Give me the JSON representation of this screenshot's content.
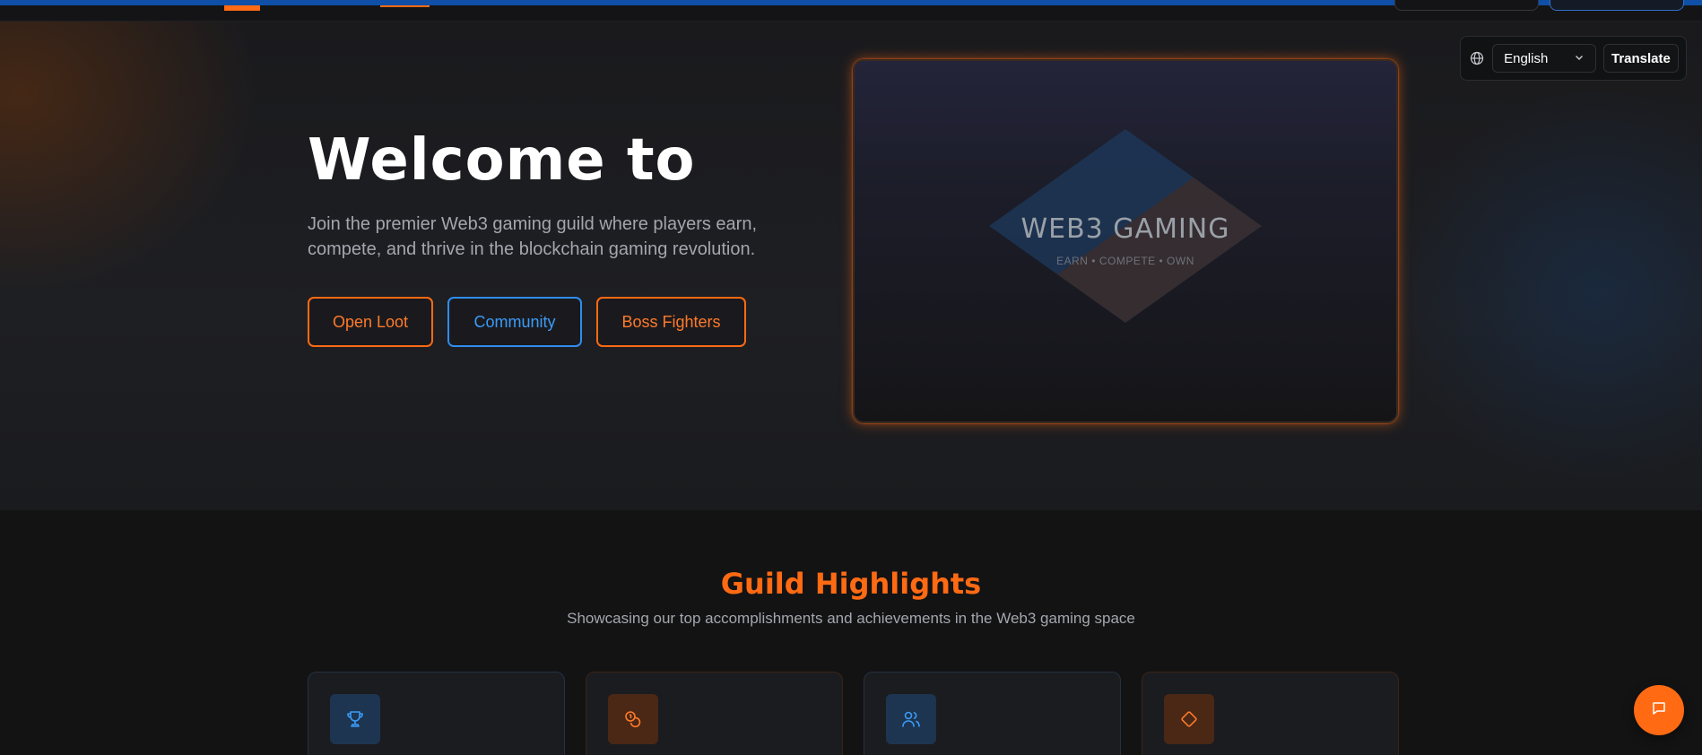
{
  "translate": {
    "language": "English",
    "button": "Translate"
  },
  "hero": {
    "title": "Welcome to",
    "subtitle": "Join the premier Web3 gaming guild where players earn, compete, and thrive in the blockchain gaming revolution.",
    "buttons": [
      {
        "label": "Open Loot",
        "style": "orange"
      },
      {
        "label": "Community",
        "style": "blue"
      },
      {
        "label": "Boss Fighters",
        "style": "orange"
      }
    ],
    "card": {
      "title": "WEB3 GAMING",
      "tagline": "EARN • COMPETE • OWN"
    }
  },
  "highlights": {
    "title": "Guild Highlights",
    "subtitle": "Showcasing our top accomplishments and achievements in the Web3 gaming space",
    "cards": [
      {
        "icon": "trophy-icon",
        "accent": "#2f8df0"
      },
      {
        "icon": "coins-icon",
        "accent": "#ff6a13"
      },
      {
        "icon": "users-icon",
        "accent": "#2f8df0"
      },
      {
        "icon": "diamond-icon",
        "accent": "#ff6a13"
      }
    ]
  },
  "colors": {
    "accent_orange": "#ff6a13",
    "accent_blue": "#2f8df0",
    "background": "#131314"
  }
}
